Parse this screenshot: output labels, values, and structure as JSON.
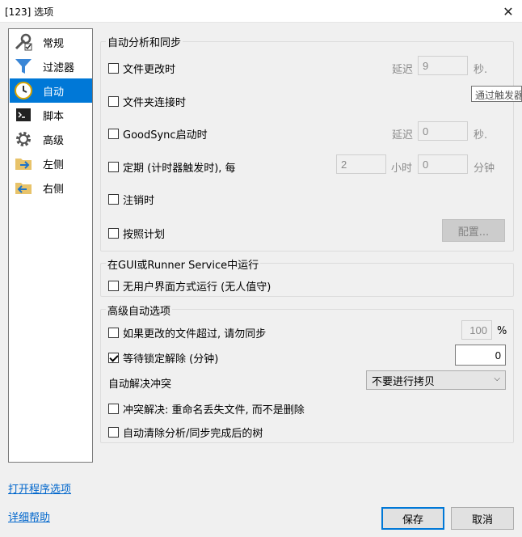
{
  "window": {
    "title": "[123] 选项",
    "close_glyph": "✕"
  },
  "nav": {
    "items": [
      {
        "label": "常规",
        "icon": "wrench-icon"
      },
      {
        "label": "过滤器",
        "icon": "filter-icon"
      },
      {
        "label": "自动",
        "icon": "clock-icon",
        "active": true
      },
      {
        "label": "脚本",
        "icon": "terminal-icon"
      },
      {
        "label": "高级",
        "icon": "gear-icon"
      },
      {
        "label": "左侧",
        "icon": "folder-left-icon"
      },
      {
        "label": "右侧",
        "icon": "folder-right-icon"
      }
    ]
  },
  "auto_sync": {
    "title": "自动分析和同步",
    "file_change": {
      "label": "文件更改时",
      "checked": false,
      "delay_label": "延迟",
      "delay_value": "9",
      "unit": "秒."
    },
    "folder_connect": {
      "label": "文件夹连接时",
      "checked": false
    },
    "goodsync_start": {
      "label": "GoodSync启动时",
      "checked": false,
      "delay_label": "延迟",
      "delay_value": "0",
      "unit": "秒."
    },
    "periodic": {
      "label": "定期 (计时器触发时), 每",
      "checked": false,
      "hours_value": "2",
      "hours_label": "小时",
      "minutes_value": "0",
      "minutes_label": "分钟"
    },
    "logoff": {
      "label": "注销时",
      "checked": false
    },
    "schedule": {
      "label": "按照计划",
      "checked": false,
      "config_button": "配置..."
    }
  },
  "tooltip": {
    "text": "通过触发器"
  },
  "runner": {
    "title": "在GUI或Runner Service中运行",
    "unattended": {
      "label": "无用户界面方式运行 (无人值守)",
      "checked": false
    }
  },
  "advanced": {
    "title": "高级自动选项",
    "too_many_changes": {
      "label": "如果更改的文件超过, 请勿同步",
      "checked": false,
      "value": "100",
      "unit": "%"
    },
    "wait_lock": {
      "label": "等待锁定解除 (分钟)",
      "checked": true,
      "value": "0"
    },
    "resolve_conflicts": {
      "label": "自动解决冲突",
      "selected": "不要进行拷贝"
    },
    "rename_lost": {
      "label": "冲突解决: 重命名丢失文件, 而不是删除",
      "checked": false
    },
    "clear_tree": {
      "label": "自动清除分析/同步完成后的树",
      "checked": false
    }
  },
  "footer": {
    "open_program_options": "打开程序选项",
    "detailed_help": "详细帮助",
    "save": "保存",
    "cancel": "取消"
  },
  "colors": {
    "accent": "#0078d7",
    "link": "#0066cc"
  }
}
